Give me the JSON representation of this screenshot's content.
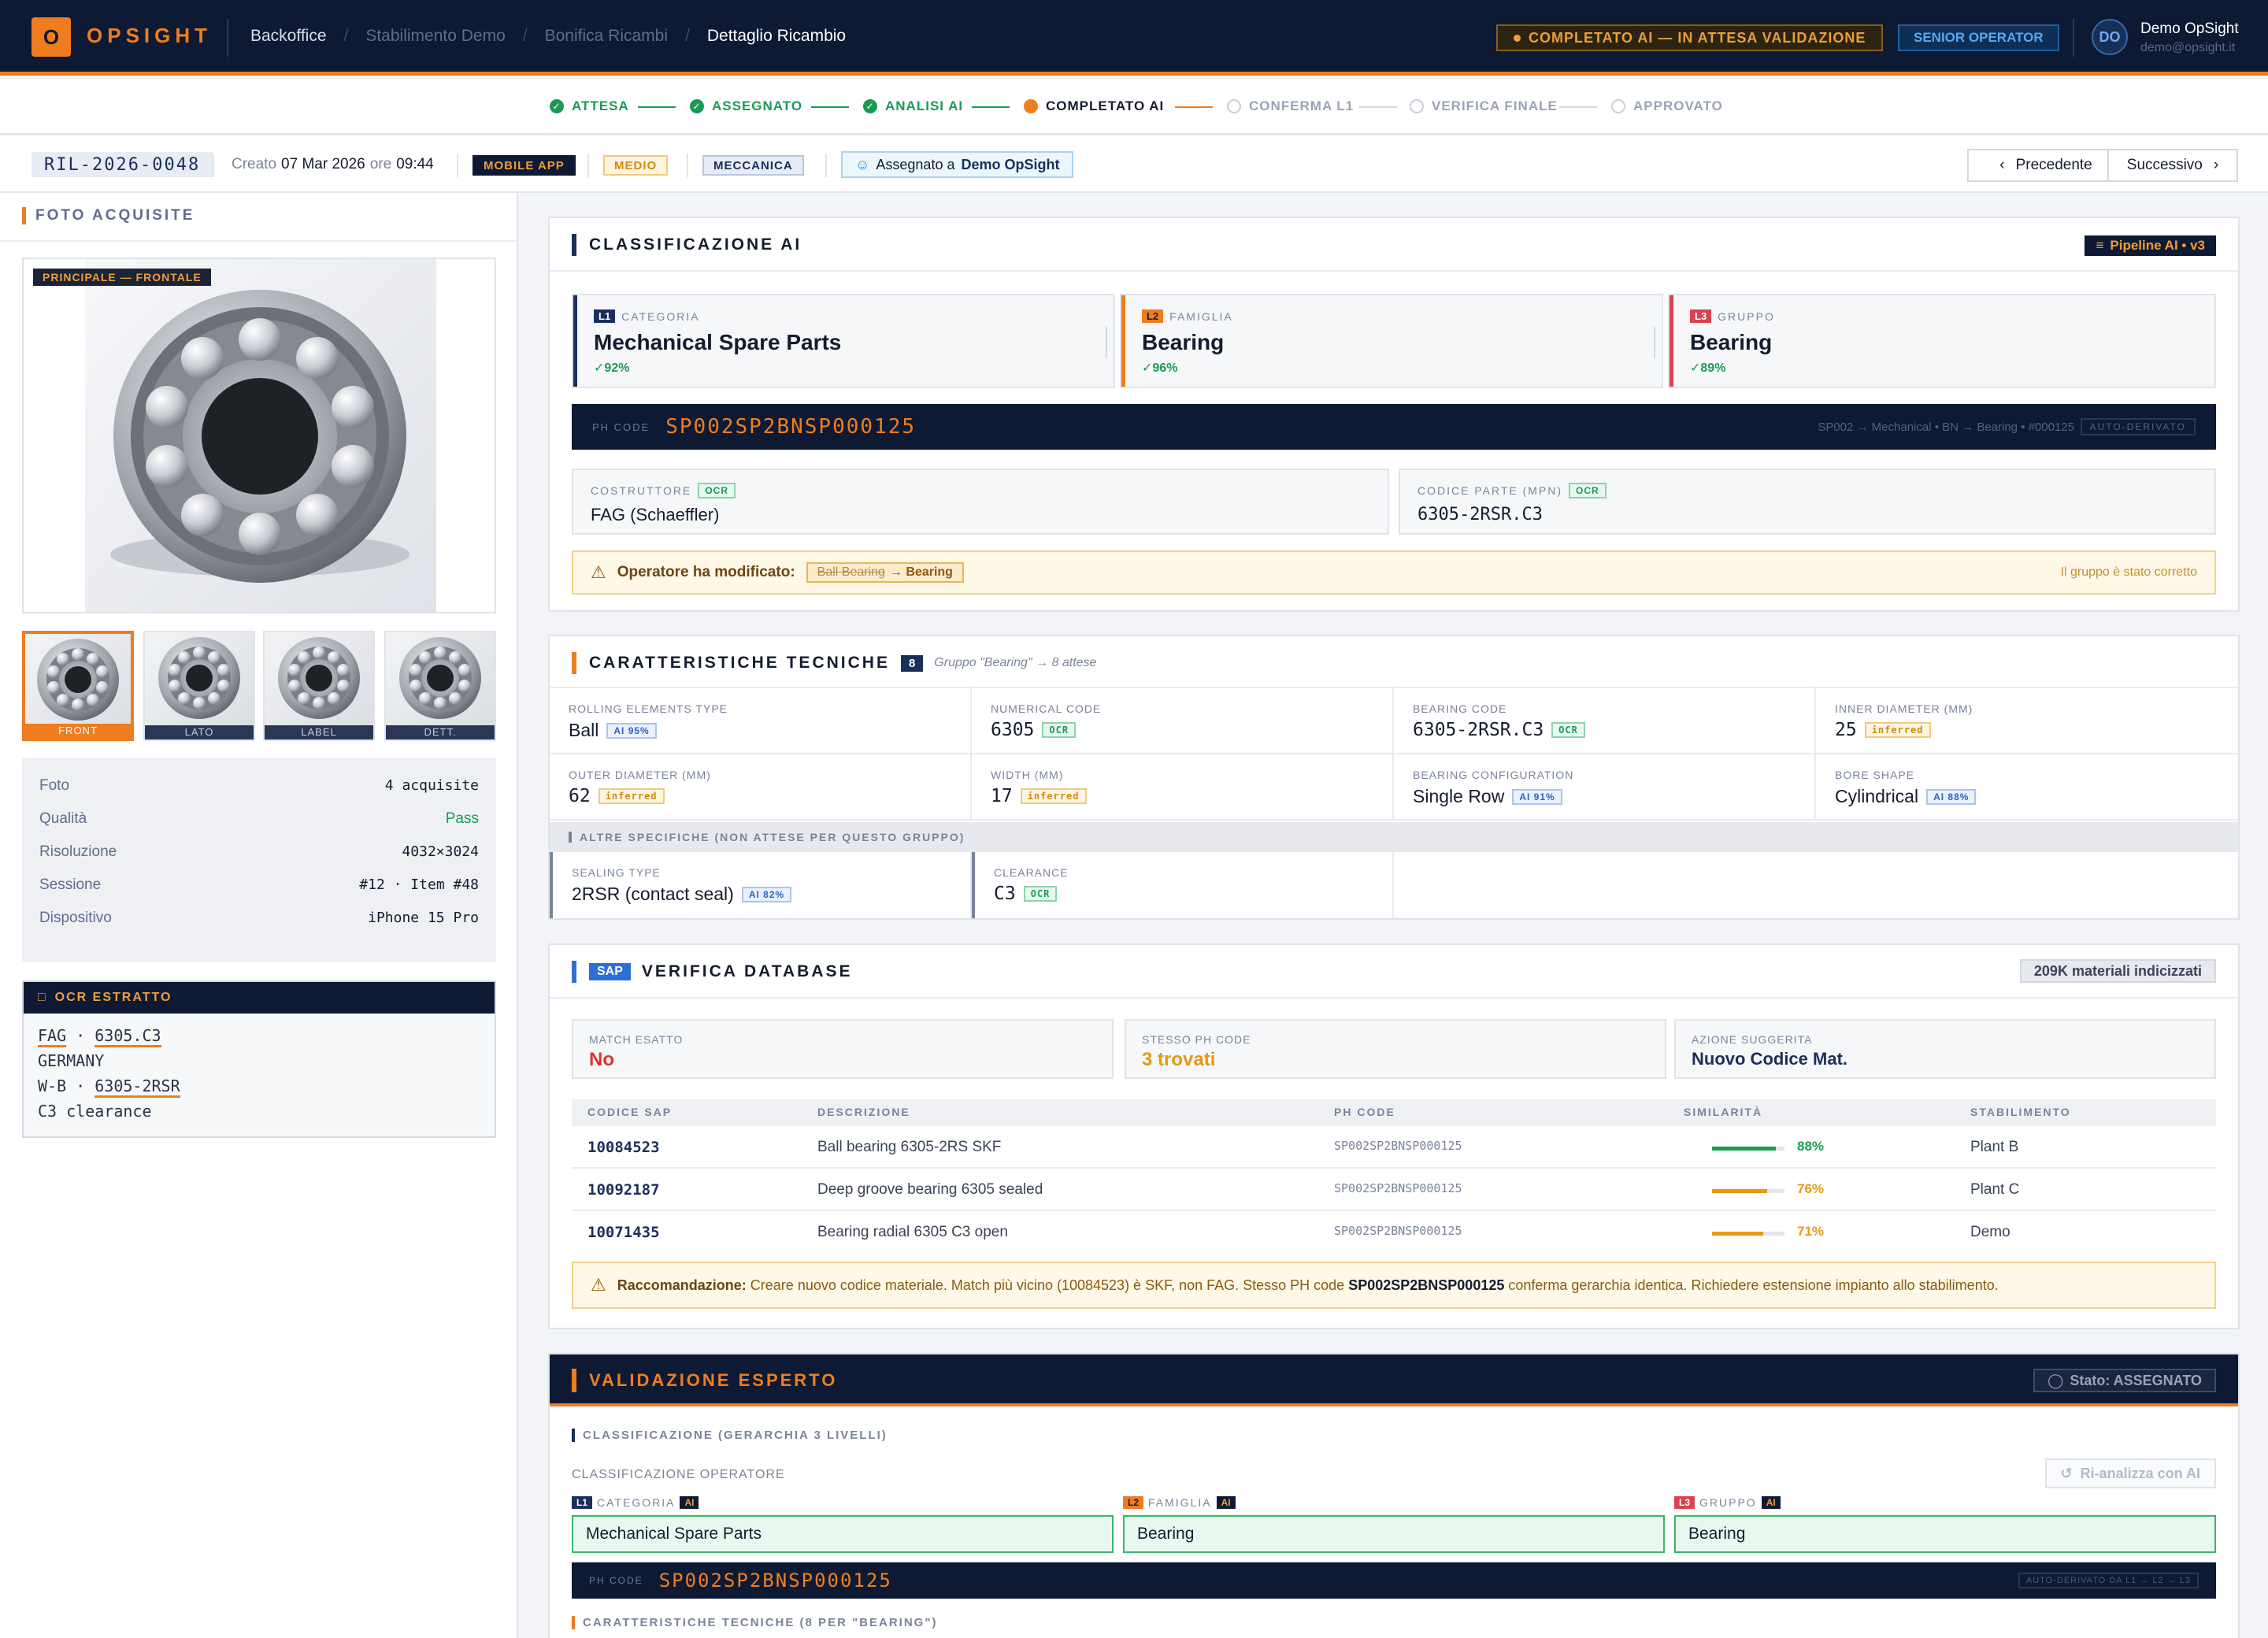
{
  "topbar": {
    "logo_letter": "O",
    "logo_text": "OPSIGHT",
    "breadcrumbs": [
      "Backoffice",
      "Stabilimento Demo",
      "Bonifica Ricambi",
      "Dettaglio Ricambio"
    ],
    "status": "COMPLETATO AI — IN ATTESA VALIDAZIONE",
    "role": "SENIOR OPERATOR",
    "avatar": "DO",
    "user_name": "Demo OpSight",
    "user_email": "demo@opsight.it"
  },
  "stepper": {
    "steps": [
      {
        "label": "ATTESA",
        "state": "done"
      },
      {
        "label": "ASSEGNATO",
        "state": "done"
      },
      {
        "label": "ANALISI AI",
        "state": "done"
      },
      {
        "label": "COMPLETATO AI",
        "state": "current"
      },
      {
        "label": "CONFERMA L1",
        "state": "todo"
      },
      {
        "label": "VERIFICA FINALE",
        "state": "todo"
      },
      {
        "label": "APPROVATO",
        "state": "todo"
      }
    ]
  },
  "subheader": {
    "id": "RIL-2026-0048",
    "created_label": "Creato",
    "created_date": "07 Mar 2026",
    "created_ore": "ore",
    "created_time": "09:44",
    "source_tag": "MOBILE APP",
    "priority_tag": "MEDIO",
    "category_tag": "MECCANICA",
    "assigned_label": "Assegnato a",
    "assigned_to": "Demo OpSight",
    "prev": "Precedente",
    "next": "Successivo"
  },
  "photos": {
    "title": "FOTO ACQUISITE",
    "main_badge": "PRINCIPALE — FRONTALE",
    "thumbs": [
      "FRONT",
      "LATO",
      "LABEL",
      "DETT."
    ],
    "meta": [
      {
        "k": "Foto",
        "v": "4 acquisite"
      },
      {
        "k": "Qualità",
        "v": "Pass"
      },
      {
        "k": "Risoluzione",
        "v": "4032×3024"
      },
      {
        "k": "Sessione",
        "v": "#12 · Item #48"
      },
      {
        "k": "Dispositivo",
        "v": "iPhone 15 Pro"
      }
    ],
    "ocr_title": "OCR ESTRATTO",
    "ocr_lines": {
      "l1a": "FAG",
      "l1b": "·",
      "l1c": "6305.C3",
      "l2": "GERMANY",
      "l3a": "W-B",
      "l3b": "·",
      "l3c": "6305-2RSR",
      "l4": "C3 clearance"
    }
  },
  "classification": {
    "title": "CLASSIFICAZIONE AI",
    "pipeline": "Pipeline AI • v3",
    "levels": [
      {
        "tag": "L1",
        "label": "CATEGORIA",
        "value": "Mechanical Spare Parts",
        "pct": "✓92%",
        "color": "#1a2f5a"
      },
      {
        "tag": "L2",
        "label": "FAMIGLIA",
        "value": "Bearing",
        "pct": "✓96%",
        "color": "#ef7d1f"
      },
      {
        "tag": "L3",
        "label": "GRUPPO",
        "value": "Bearing",
        "pct": "✓89%",
        "color": "#d9434f"
      }
    ],
    "ph_label": "PH CODE",
    "ph_code": "SP002SP2BNSP000125",
    "ph_path": "SP002 → Mechanical • BN → Bearing • #000125",
    "ph_auto": "AUTO-DERIVATO",
    "manufacturer_label": "COSTRUTTORE",
    "manufacturer_badge": "OCR",
    "manufacturer": "FAG (Schaeffler)",
    "mpn_label": "CODICE PARTE (MPN)",
    "mpn_badge": "OCR",
    "mpn": "6305-2RSR.C3",
    "warn_label": "Operatore ha modificato:",
    "warn_old": "Ball Bearing",
    "warn_new": "→ Bearing",
    "warn_note": "Il gruppo è stato corretto"
  },
  "tech": {
    "title": "CARATTERISTICHE TECNICHE",
    "count": "8",
    "note": "Gruppo \"Bearing\" → 8 attese",
    "cells": [
      {
        "label": "ROLLING ELEMENTS TYPE",
        "value": "Ball",
        "badge": "AI 95%",
        "kind": "ai"
      },
      {
        "label": "NUMERICAL CODE",
        "value": "6305",
        "badge": "OCR",
        "kind": "ocr"
      },
      {
        "label": "BEARING CODE",
        "value": "6305-2RSR.C3",
        "badge": "OCR",
        "kind": "ocr"
      },
      {
        "label": "INNER DIAMETER (MM)",
        "value": "25",
        "badge": "inferred",
        "kind": "inf"
      },
      {
        "label": "OUTER DIAMETER (MM)",
        "value": "62",
        "badge": "inferred",
        "kind": "inf"
      },
      {
        "label": "WIDTH (MM)",
        "value": "17",
        "badge": "inferred",
        "kind": "inf"
      },
      {
        "label": "BEARING CONFIGURATION",
        "value": "Single Row",
        "badge": "AI 91%",
        "kind": "ai"
      },
      {
        "label": "BORE SHAPE",
        "value": "Cylindrical",
        "badge": "AI 88%",
        "kind": "ai"
      }
    ],
    "other_title": "ALTRE SPECIFICHE (NON ATTESE PER QUESTO GRUPPO)",
    "other": [
      {
        "label": "SEALING TYPE",
        "value": "2RSR (contact seal)",
        "badge": "AI 82%",
        "kind": "ai"
      },
      {
        "label": "CLEARANCE",
        "value": "C3",
        "badge": "OCR",
        "kind": "ocr"
      }
    ]
  },
  "sap": {
    "badge": "SAP",
    "title": "VERIFICA DATABASE",
    "indexed": "209K materiali indicizzati",
    "stats": [
      {
        "label": "MATCH ESATTO",
        "value": "No",
        "color": "#d9342b"
      },
      {
        "label": "STESSO PH CODE",
        "value": "3 trovati",
        "color": "#e59a12"
      },
      {
        "label": "AZIONE SUGGERITA",
        "value": "Nuovo Codice Mat.",
        "color": "#1a2f5a"
      }
    ],
    "headers": [
      "CODICE SAP",
      "DESCRIZIONE",
      "PH CODE",
      "SIMILARITÀ",
      "STABILIMENTO"
    ],
    "rows": [
      {
        "code": "10084523",
        "desc": "Ball bearing 6305-2RS SKF",
        "ph": "SP002SP2BNSP000125",
        "sim": 88,
        "sim_label": "88%",
        "color": "#1b9a54",
        "plant": "Plant B"
      },
      {
        "code": "10092187",
        "desc": "Deep groove bearing 6305 sealed",
        "ph": "SP002SP2BNSP000125",
        "sim": 76,
        "sim_label": "76%",
        "color": "#e59a12",
        "plant": "Plant C"
      },
      {
        "code": "10071435",
        "desc": "Bearing radial 6305 C3 open",
        "ph": "SP002SP2BNSP000125",
        "sim": 71,
        "sim_label": "71%",
        "color": "#e59a12",
        "plant": "Demo"
      }
    ],
    "rec_label": "Raccomandazione:",
    "rec_text1": "Creare nuovo codice materiale. Match più vicino (10084523) è SKF, non FAG. Stesso PH code",
    "rec_code": "SP002SP2BNSP000125",
    "rec_text2": "conferma gerarchia identica. Richiedere estensione impianto allo stabilimento."
  },
  "validation": {
    "title": "VALIDAZIONE ESPERTO",
    "state": "Stato: ASSEGNATO",
    "section1": "CLASSIFICAZIONE (GERARCHIA 3 LIVELLI)",
    "op_label": "CLASSIFICAZIONE OPERATORE",
    "reanalyze": "Ri-analizza con AI",
    "fields": [
      {
        "tag": "L1",
        "label": "CATEGORIA",
        "ai": "AI",
        "value": "Mechanical Spare Parts",
        "color": "#1a2f5a"
      },
      {
        "tag": "L2",
        "label": "FAMIGLIA",
        "ai": "AI",
        "value": "Bearing",
        "color": "#ef7d1f"
      },
      {
        "tag": "L3",
        "label": "GRUPPO",
        "ai": "AI",
        "value": "Bearing",
        "color": "#d9434f"
      }
    ],
    "ph_label": "PH CODE",
    "ph_code": "SP002SP2BNSP000125",
    "ph_auto": "AUTO-DERIVATO DA L1 → L2 → L3",
    "section2": "CARATTERISTICHE TECNICHE (8 PER \"BEARING\")"
  }
}
